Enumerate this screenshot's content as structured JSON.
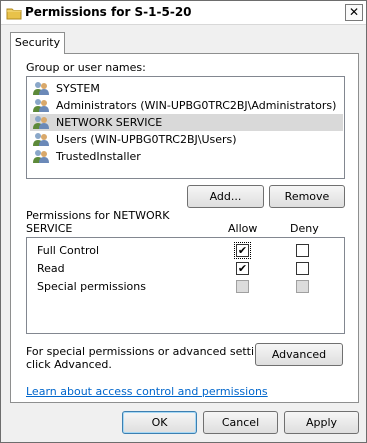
{
  "window": {
    "title": "Permissions for S-1-5-20",
    "close_glyph": "✕"
  },
  "tabs": [
    {
      "label": "Security"
    }
  ],
  "groups": {
    "label": "Group or user names:",
    "items": [
      {
        "name": "SYSTEM",
        "selected": false
      },
      {
        "name": "Administrators (WIN-UPBG0TRC2BJ\\Administrators)",
        "selected": false
      },
      {
        "name": "NETWORK SERVICE",
        "selected": true
      },
      {
        "name": "Users (WIN-UPBG0TRC2BJ\\Users)",
        "selected": false
      },
      {
        "name": "TrustedInstaller",
        "selected": false
      }
    ],
    "add_label": "Add...",
    "remove_label": "Remove"
  },
  "permissions": {
    "label_line1": "Permissions for NETWORK",
    "label_line2": "SERVICE",
    "allow_header": "Allow",
    "deny_header": "Deny",
    "rows": [
      {
        "name": "Full Control",
        "allow": "checked",
        "deny": "unchecked"
      },
      {
        "name": "Read",
        "allow": "checked",
        "deny": "unchecked"
      },
      {
        "name": "Special permissions",
        "allow": "disabled",
        "deny": "disabled"
      }
    ]
  },
  "advanced": {
    "text_line1": "For special permissions or advanced settings,",
    "text_line2": "click Advanced.",
    "button_label": "Advanced"
  },
  "help_link": "Learn about access control and permissions",
  "footer": {
    "ok_label": "OK",
    "cancel_label": "Cancel",
    "apply_label": "Apply"
  },
  "colors": {
    "link": "#0066cc",
    "selected_row": "#d9d9d9",
    "default_button_border": "#3c7fb1"
  },
  "icons": {
    "title": "folder-icon",
    "user": "users-group-icon",
    "check": "✔"
  }
}
